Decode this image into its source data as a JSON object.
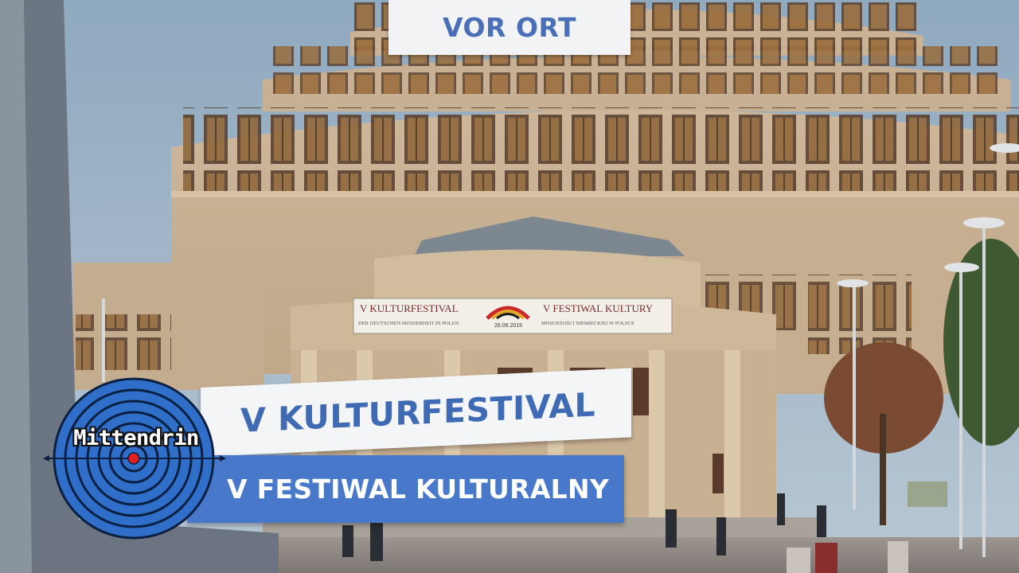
{
  "top_tag": {
    "label": "VOR ORT"
  },
  "lower_third": {
    "title": "V KULTURFESTIVAL",
    "subtitle": "V FESTIWAL KULTURALNY"
  },
  "logo": {
    "text": "Mittendrin",
    "icon": "target-rings-icon"
  },
  "banner": {
    "left_title": "V KULTURFESTIVAL",
    "left_sub": "DER DEUTSCHEN MINDERHEIT IN POLEN",
    "date": "26.09.2015",
    "right_title": "V FESTIWAL KULTURY",
    "right_sub": "MNIEJSZOŚCI NIEMIECKIEJ W POLSCE"
  },
  "colors": {
    "accent_blue": "#4778c9",
    "tag_text": "#4a6fb8",
    "logo_blue": "#2f6ec9",
    "logo_dot": "#e01f1f"
  }
}
